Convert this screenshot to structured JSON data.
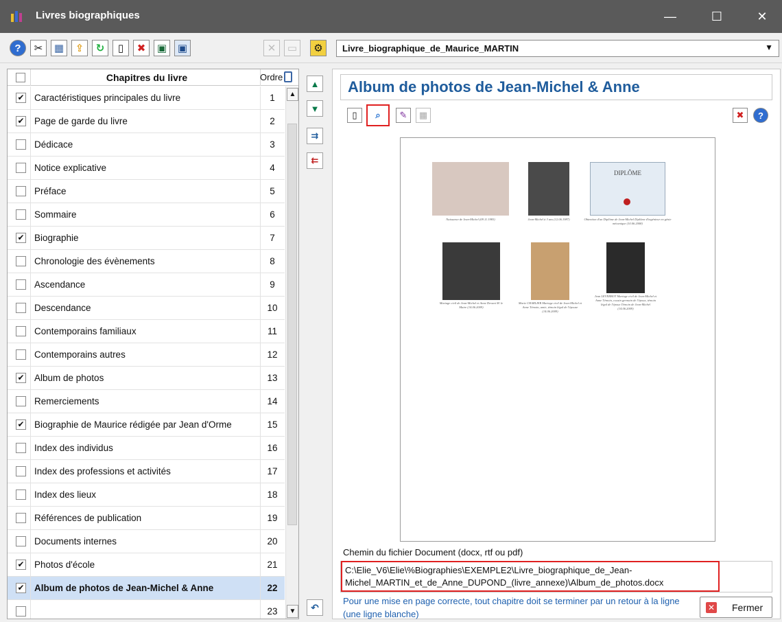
{
  "window": {
    "title": "Livres biographiques",
    "minimize": "—",
    "maximize": "☐",
    "close": "✕"
  },
  "toolbar": {
    "book_select_value": "Livre_biographique_de_Maurice_MARTIN",
    "icons": [
      "help-icon",
      "tools-icon",
      "settings-grid-icon",
      "export-icon",
      "refresh-icon",
      "new-page-icon",
      "delete-icon",
      "save-icon",
      "save-as-icon",
      "disabled-x-icon",
      "disabled-blank-icon",
      "gear-icon"
    ]
  },
  "chapter_list": {
    "header_name": "Chapitres du livre",
    "header_order": "Ordre",
    "rows": [
      {
        "checked": true,
        "name": "Caractéristiques principales du livre",
        "order": "1"
      },
      {
        "checked": true,
        "name": "Page de garde du livre",
        "order": "2"
      },
      {
        "checked": false,
        "name": "Dédicace",
        "order": "3"
      },
      {
        "checked": false,
        "name": "Notice explicative",
        "order": "4"
      },
      {
        "checked": false,
        "name": "Préface",
        "order": "5"
      },
      {
        "checked": false,
        "name": "Sommaire",
        "order": "6"
      },
      {
        "checked": true,
        "name": "Biographie",
        "order": "7"
      },
      {
        "checked": false,
        "name": "Chronologie des évènements",
        "order": "8"
      },
      {
        "checked": false,
        "name": "Ascendance",
        "order": "9"
      },
      {
        "checked": false,
        "name": "Descendance",
        "order": "10"
      },
      {
        "checked": false,
        "name": "Contemporains familiaux",
        "order": "11"
      },
      {
        "checked": false,
        "name": "Contemporains autres",
        "order": "12"
      },
      {
        "checked": true,
        "name": "Album de photos",
        "order": "13"
      },
      {
        "checked": false,
        "name": "Remerciements",
        "order": "14"
      },
      {
        "checked": true,
        "name": "Biographie de Maurice rédigée par Jean d'Orme",
        "order": "15"
      },
      {
        "checked": false,
        "name": "Index des individus",
        "order": "16"
      },
      {
        "checked": false,
        "name": "Index des professions et activités",
        "order": "17"
      },
      {
        "checked": false,
        "name": "Index des lieux",
        "order": "18"
      },
      {
        "checked": false,
        "name": "Références de publication",
        "order": "19"
      },
      {
        "checked": false,
        "name": "Documents internes",
        "order": "20"
      },
      {
        "checked": true,
        "name": "Photos d'école",
        "order": "21"
      },
      {
        "checked": true,
        "name": "Album de photos de Jean-Michel & Anne",
        "order": "22",
        "selected": true
      },
      {
        "checked": false,
        "name": "",
        "order": "23"
      }
    ]
  },
  "chapter_panel": {
    "title": "Album de photos de Jean-Michel & Anne",
    "preview": {
      "diploma_title": "DIPLÔME",
      "captions": [
        "Naissance de Jean-Michel (09.11.1983)",
        "Jean-Michel à 3 ans (12.06.1987)",
        "Obtention d'un Diplôme de Jean-Michel Diplôme d'ingénieur en génie mécanique (10.06.2008)",
        "Mariage civil de Jean-Michel et Anne Devant M. le Maire (14.06.2009)",
        "Marie CHARLIER Mariage civil de Jean-Michel et Anne Témoin, amie, témoin légal de l'épouse (14.06.2009)",
        "Jean LEVERBOT Mariage civil de Jean-Michel et Anne Témoin, cousin germain de l'époux, témoin légal de l'époux Témoin de Jean-Michel (14.06.2009)"
      ]
    },
    "path_label": "Chemin du fichier Document (docx, rtf ou pdf)",
    "path_value": "C:\\Elie_V6\\Elie\\%Biographies\\EXEMPLE2\\Livre_biographique_de_Jean-Michel_MARTIN_et_de_Anne_DUPOND_(livre_annexe)\\Album_de_photos.docx",
    "note": "Pour une mise en page correcte, tout chapitre doit se terminer par un retour à la ligne (une ligne blanche)",
    "close_label": "Fermer"
  }
}
